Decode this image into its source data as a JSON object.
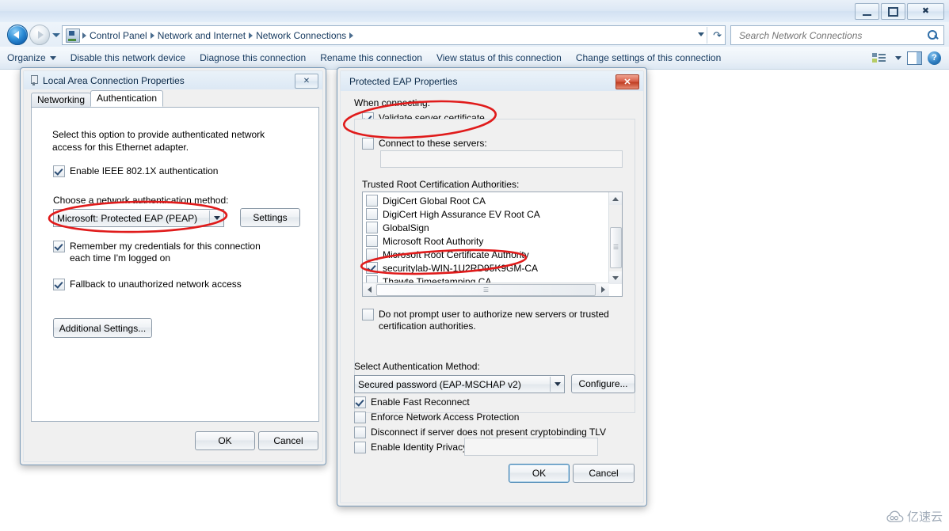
{
  "window": {
    "titlebar_buttons": [
      {
        "name": "minimize",
        "glyph": "minimize-icon"
      },
      {
        "name": "restore",
        "glyph": "restore-icon"
      },
      {
        "name": "close",
        "glyph": "close-icon"
      }
    ]
  },
  "address_bar": {
    "icon": "network-connections-icon",
    "breadcrumbs": [
      "Control Panel",
      "Network and Internet",
      "Network Connections"
    ],
    "dropdown_icon": "chevron-down-icon",
    "refresh_icon": "refresh-icon"
  },
  "search": {
    "placeholder": "Search Network Connections",
    "value": "",
    "icon": "search-icon"
  },
  "command_bar": {
    "items": [
      "Organize",
      "Disable this network device",
      "Diagnose this connection",
      "Rename this connection",
      "View status of this connection",
      "Change settings of this connection"
    ],
    "views_icon": "views-icon",
    "preview_pane_icon": "preview-pane-icon",
    "help_icon": "help-icon"
  },
  "lan_dialog": {
    "title": "Local Area Connection Properties",
    "title_icon": "network-adapter-icon",
    "close_label": "✕",
    "tabs": [
      {
        "label": "Networking",
        "active": false
      },
      {
        "label": "Authentication",
        "active": true
      }
    ],
    "description": "Select this option to provide authenticated network access for this Ethernet adapter.",
    "enable_8021x": {
      "label": "Enable IEEE 802.1X authentication",
      "checked": true
    },
    "method_label": "Choose a network authentication method:",
    "method_value": "Microsoft: Protected EAP (PEAP)",
    "settings_button": "Settings",
    "remember_credentials": {
      "label": "Remember my credentials for this connection each time I'm logged on",
      "checked": true
    },
    "fallback": {
      "label": "Fallback to unauthorized network access",
      "checked": true
    },
    "additional_settings_button": "Additional Settings...",
    "ok_button": "OK",
    "cancel_button": "Cancel"
  },
  "peap_dialog": {
    "title": "Protected EAP Properties",
    "close_label": "✕",
    "when_connecting_label": "When connecting:",
    "validate_server_certificate": {
      "label": "Validate server certificate",
      "checked": true
    },
    "connect_to_these_servers": {
      "label": "Connect to these servers:",
      "checked": false
    },
    "servers_value": "",
    "trusted_roots_label": "Trusted Root Certification Authorities:",
    "trusted_roots": [
      {
        "label": "DigiCert Global Root CA",
        "checked": false
      },
      {
        "label": "DigiCert High Assurance EV Root CA",
        "checked": false
      },
      {
        "label": "GlobalSign",
        "checked": false
      },
      {
        "label": "Microsoft Root Authority",
        "checked": false
      },
      {
        "label": "Microsoft Root Certificate Authority",
        "checked": false
      },
      {
        "label": "securitylab-WIN-1U2RD95K9GM-CA",
        "checked": true
      },
      {
        "label": "Thawte Timestamping CA",
        "checked": false
      }
    ],
    "do_not_prompt": {
      "label": "Do not prompt user to authorize new servers or trusted certification authorities.",
      "checked": false
    },
    "select_auth_method_label": "Select Authentication Method:",
    "auth_method_value": "Secured password (EAP-MSCHAP v2)",
    "configure_button": "Configure...",
    "enable_fast_reconnect": {
      "label": "Enable Fast Reconnect",
      "checked": true
    },
    "enforce_nap": {
      "label": "Enforce Network Access Protection",
      "checked": false
    },
    "disconnect_cryptobinding": {
      "label": "Disconnect if server does not present cryptobinding TLV",
      "checked": false
    },
    "enable_identity_privacy": {
      "label": "Enable Identity Privacy",
      "checked": false
    },
    "identity_privacy_value": "",
    "ok_button": "OK",
    "cancel_button": "Cancel"
  },
  "annotations": {
    "color": "#e01b1b",
    "shapes": [
      {
        "name": "peap-method-highlight",
        "target": "Microsoft: Protected EAP (PEAP)"
      },
      {
        "name": "validate-server-certificate-highlight",
        "target": "Validate server certificate"
      },
      {
        "name": "securitylab-ca-highlight",
        "target": "securitylab-WIN-1U2RD95K9GM-CA"
      }
    ]
  },
  "watermark": {
    "text": "亿速云",
    "icon": "cloud-icon"
  }
}
